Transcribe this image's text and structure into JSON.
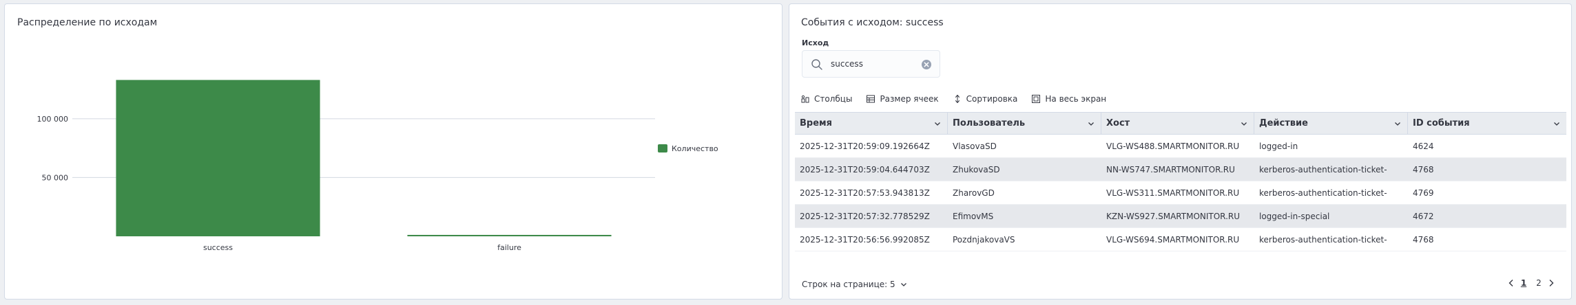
{
  "left_panel": {
    "title": "Распределение по исходам"
  },
  "chart_data": {
    "type": "bar",
    "categories": [
      "success",
      "failure"
    ],
    "series": [
      {
        "name": "Количество",
        "values": [
          133000,
          1200
        ],
        "color": "#3d8a49"
      }
    ],
    "ylim": [
      0,
      142000
    ],
    "yticks": [
      50000,
      100000
    ],
    "ytick_labels": [
      "50 000",
      "100 000"
    ],
    "grid": true,
    "legend": "right"
  },
  "right_panel": {
    "title": "События с исходом: success",
    "filter": {
      "label": "Исход",
      "value": "success"
    },
    "toolbar": {
      "columns": "Столбцы",
      "cell_size": "Размер ячеек",
      "sort": "Сортировка",
      "fullscreen": "На весь экран"
    },
    "table": {
      "columns": [
        "Время",
        "Пользователь",
        "Хост",
        "Действие",
        "ID события"
      ],
      "rows": [
        [
          "2025-12-31T20:59:09.192664Z",
          "VlasovaSD",
          "VLG-WS488.SMARTMONITOR.RU",
          "logged-in",
          "4624"
        ],
        [
          "2025-12-31T20:59:04.644703Z",
          "ZhukovaSD",
          "NN-WS747.SMARTMONITOR.RU",
          "kerberos-authentication-ticket-",
          "4768"
        ],
        [
          "2025-12-31T20:57:53.943813Z",
          "ZharovGD",
          "VLG-WS311.SMARTMONITOR.RU",
          "kerberos-authentication-ticket-",
          "4769"
        ],
        [
          "2025-12-31T20:57:32.778529Z",
          "EfimovMS",
          "KZN-WS927.SMARTMONITOR.RU",
          "logged-in-special",
          "4672"
        ],
        [
          "2025-12-31T20:56:56.992085Z",
          "PozdnjakovaVS",
          "VLG-WS694.SMARTMONITOR.RU",
          "kerberos-authentication-ticket-",
          "4768"
        ]
      ]
    },
    "footer": {
      "rows_per_page": "Строк на странице: 5",
      "pages": [
        "1",
        "2"
      ],
      "current_page": "1"
    }
  }
}
